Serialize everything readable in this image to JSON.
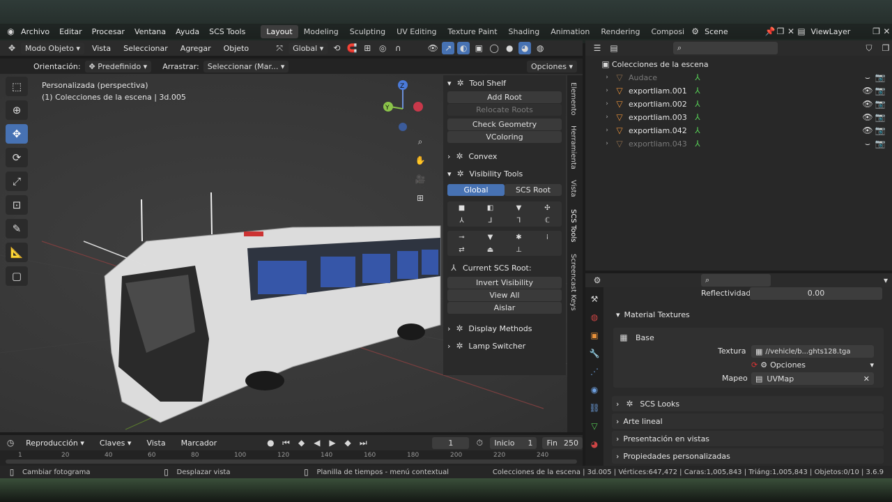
{
  "menu": [
    "Archivo",
    "Editar",
    "Procesar",
    "Ventana",
    "Ayuda",
    "SCS Tools"
  ],
  "workspaces": [
    "Layout",
    "Modeling",
    "Sculpting",
    "UV Editing",
    "Texture Paint",
    "Shading",
    "Animation",
    "Rendering",
    "Composi"
  ],
  "scene_label": "Scene",
  "viewlayer_label": "ViewLayer",
  "viewport_header": {
    "mode": "Modo Objeto",
    "items": [
      "Vista",
      "Seleccionar",
      "Agregar",
      "Objeto"
    ],
    "transform": "Global"
  },
  "viewport_header2": {
    "orientation_label": "Orientación:",
    "orientation_value": "Predefinido",
    "drag_label": "Arrastrar:",
    "drag_value": "Seleccionar (Mar...",
    "options": "Opciones"
  },
  "viewport_info": {
    "line1": "Personalizada (perspectiva)",
    "line2": "(1) Colecciones de la escena | 3d.005"
  },
  "tool_shelf": {
    "title": "Tool Shelf",
    "add_root": "Add Root",
    "relocate_roots": "Relocate Roots",
    "check_geometry": "Check Geometry",
    "vcoloring": "VColoring",
    "convex": "Convex",
    "visibility_tools": "Visibility Tools",
    "global": "Global",
    "scs_root": "SCS Root",
    "current_root": "Current SCS Root:",
    "invert_visibility": "Invert Visibility",
    "view_all": "View All",
    "aislar": "Aislar",
    "display_methods": "Display Methods",
    "lamp_switcher": "Lamp Switcher"
  },
  "side_tabs": [
    "Elemento",
    "Herramienta",
    "Vista",
    "SCS Tools",
    "Screencast Keys"
  ],
  "outliner": {
    "title": "Colecciones de la escena",
    "items": [
      {
        "name": "Audace",
        "dim": true
      },
      {
        "name": "exportliam.001",
        "dim": false
      },
      {
        "name": "exportliam.002",
        "dim": false
      },
      {
        "name": "exportliam.003",
        "dim": false
      },
      {
        "name": "exportliam.042",
        "dim": false
      },
      {
        "name": "exportliam.043",
        "dim": true
      }
    ]
  },
  "properties": {
    "reflectividad_label": "Reflectividad",
    "reflectividad_value": "0.00",
    "material_textures": "Material Textures",
    "base": "Base",
    "textura_label": "Textura",
    "textura_value": "//vehicle/b...ghts128.tga",
    "opciones": "Opciones",
    "mapeo_label": "Mapeo",
    "mapeo_value": "UVMap",
    "scs_looks": "SCS Looks",
    "arte_lineal": "Arte lineal",
    "presentacion": "Presentación en vistas",
    "propiedades": "Propiedades personalizadas"
  },
  "timeline": {
    "reproduccion": "Reproducción",
    "claves": "Claves",
    "vista": "Vista",
    "marcador": "Marcador",
    "current_frame": "1",
    "inicio_label": "Inicio",
    "inicio_value": "1",
    "fin_label": "Fin",
    "fin_value": "250",
    "ruler_marks": [
      "1",
      "20",
      "40",
      "60",
      "80",
      "100",
      "120",
      "140",
      "160",
      "180",
      "200",
      "220",
      "240"
    ]
  },
  "status": {
    "left1": "Cambiar fotograma",
    "left2": "Desplazar vista",
    "center": "Planilla de tiempos - menú contextual",
    "right": "Colecciones de la escena | 3d.005 | Vértices:647,472 | Caras:1,005,843 | Triáng:1,005,843 | Objetos:0/10 | 3.6.9"
  }
}
